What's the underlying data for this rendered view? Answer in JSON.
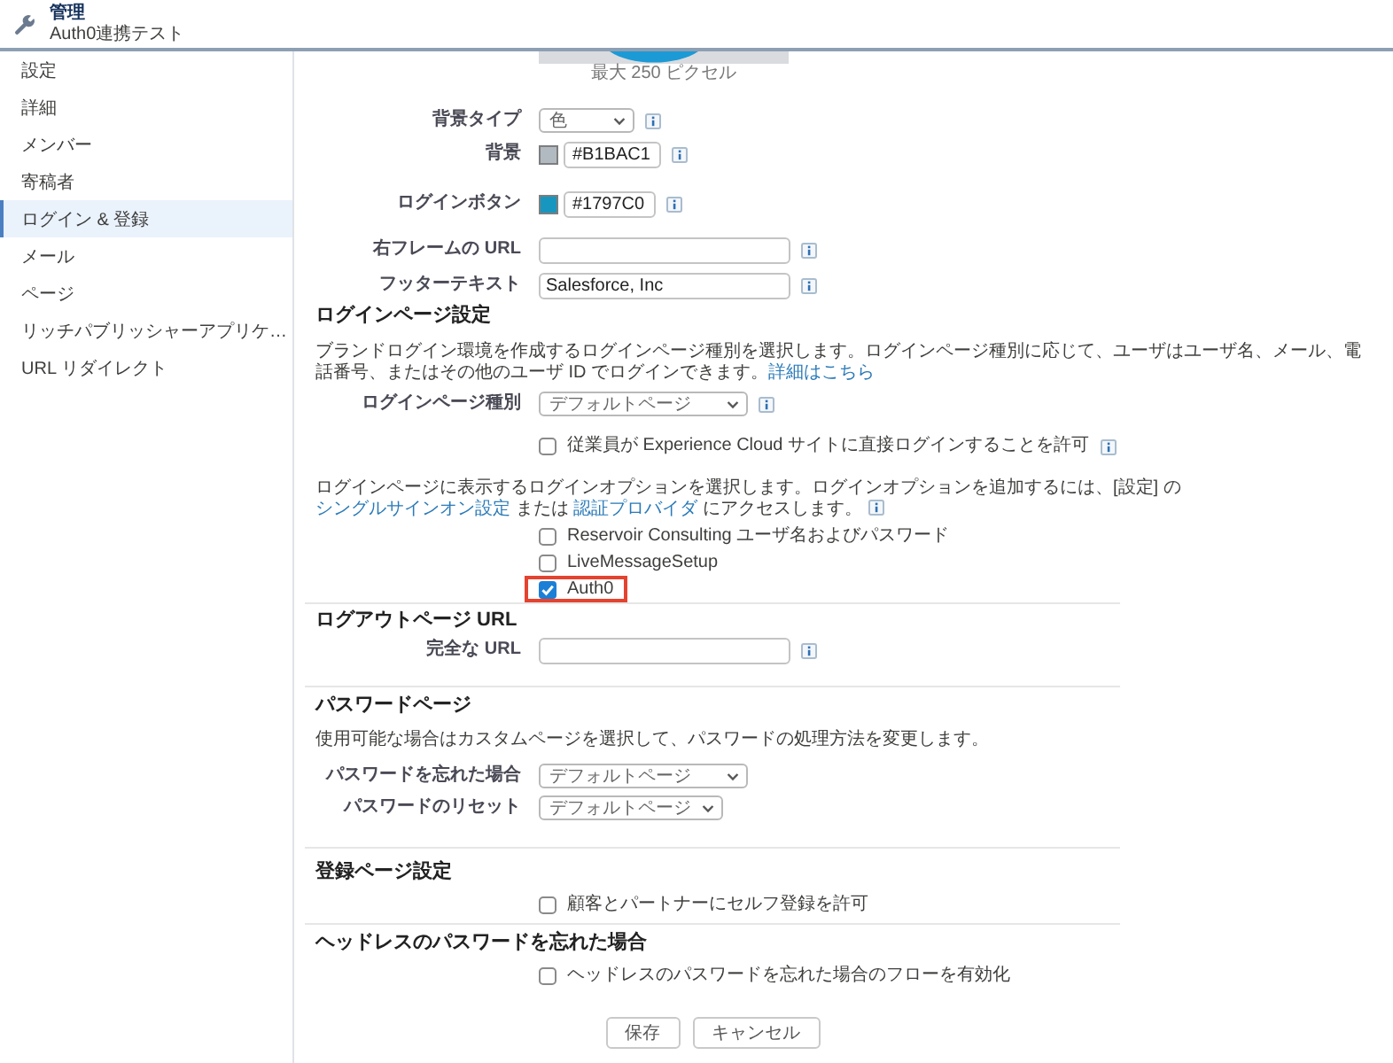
{
  "header": {
    "title": "管理",
    "subtitle": "Auth0連携テスト"
  },
  "sidebar": {
    "items": [
      {
        "label": "設定",
        "selected": false
      },
      {
        "label": "詳細",
        "selected": false
      },
      {
        "label": "メンバー",
        "selected": false
      },
      {
        "label": "寄稿者",
        "selected": false
      },
      {
        "label": "ログイン & 登録",
        "selected": true
      },
      {
        "label": "メール",
        "selected": false
      },
      {
        "label": "ページ",
        "selected": false
      },
      {
        "label": "リッチパブリッシャーアプリケ…",
        "selected": false
      },
      {
        "label": "URL リダイレクト",
        "selected": false
      }
    ]
  },
  "logo": {
    "caption": "最大 250 ピクセル"
  },
  "branding": {
    "fields": [
      {
        "kind": "select",
        "label": "背景タイプ",
        "value": "色"
      },
      {
        "kind": "color",
        "label": "背景",
        "value": "#B1BAC1",
        "color": "#b1bac1"
      },
      {
        "kind": "color",
        "label": "ログインボタン",
        "value": "#1797C0",
        "color": "#1797c0"
      },
      {
        "kind": "text",
        "label": "右フレームの URL"
      },
      {
        "kind": "text",
        "label": "フッターテキスト",
        "value": "Salesforce, Inc"
      }
    ]
  },
  "login_page": {
    "heading": "ログインページ設定",
    "description": [
      {
        "kind": "text",
        "text": "ブランドログイン環境を作成するログインページ種別を選択します。ログインページ種別に応じて、ユーザはユーザ名、メール、電話番号、またはその他のユーザ ID でログインできます。"
      },
      {
        "kind": "link",
        "text": "詳細はこちら"
      }
    ],
    "page_type": {
      "kind": "select",
      "label": "ログインページ種別",
      "value": "デフォルトページ"
    },
    "employee_login": {
      "label": "従業員が Experience Cloud サイトに直接ログインすることを許可",
      "checked": false
    },
    "options_description": [
      {
        "kind": "text",
        "text": "ログインページに表示するログインオプションを選択します。ログインオプションを追加するには、[設定] の "
      },
      {
        "kind": "link",
        "text": "シングルサインオン設定"
      },
      {
        "kind": "text",
        "text": " または "
      },
      {
        "kind": "link",
        "text": "認証プロバイダ"
      },
      {
        "kind": "text",
        "text": " にアクセスします。"
      }
    ],
    "options": [
      {
        "label": "Reservoir Consulting ユーザ名およびパスワード",
        "checked": false,
        "highlighted": false
      },
      {
        "label": "LiveMessageSetup",
        "checked": false,
        "highlighted": false
      },
      {
        "label": "Auth0",
        "checked": true,
        "highlighted": true
      }
    ]
  },
  "logout_page": {
    "heading": "ログアウトページ URL",
    "field": {
      "kind": "text",
      "label": "完全な URL"
    }
  },
  "password_page": {
    "heading": "パスワードページ",
    "description": "使用可能な場合はカスタムページを選択して、パスワードの処理方法を変更します。",
    "fields": [
      {
        "kind": "select",
        "label": "パスワードを忘れた場合",
        "value": "デフォルトページ"
      },
      {
        "kind": "select",
        "label": "パスワードのリセット",
        "value": "デフォルトページ"
      }
    ]
  },
  "registration_page": {
    "heading": "登録ページ設定",
    "self_registration": {
      "label": "顧客とパートナーにセルフ登録を許可",
      "checked": false
    }
  },
  "headless_forgot_password": {
    "heading": "ヘッドレスのパスワードを忘れた場合",
    "flow": {
      "label": "ヘッドレスのパスワードを忘れた場合のフローを有効化",
      "checked": false
    }
  },
  "buttons": [
    {
      "label": "保存"
    },
    {
      "label": "キャンセル"
    }
  ]
}
